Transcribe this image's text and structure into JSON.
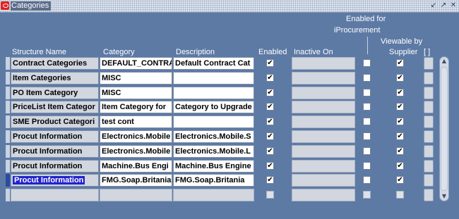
{
  "window": {
    "title": "Categories",
    "controls": [
      "↙",
      "↗",
      "✕"
    ]
  },
  "headers": {
    "structure_name": "Structure Name",
    "category": "Category",
    "description": "Description",
    "enabled": "Enabled",
    "inactive_on": "Inactive On",
    "enabled_for_iproc_line1": "Enabled for",
    "enabled_for_iproc_line2": "iProcurement",
    "viewable_line1": "Viewable by",
    "viewable_line2": "Supplier",
    "dff": "[ ]"
  },
  "rows": [
    {
      "structure": "Contract Categories",
      "category": "DEFAULT_CONTRA",
      "description": "Default Contract Cat",
      "enabled": true,
      "inactive_on": "",
      "iproc": false,
      "viewable": true
    },
    {
      "structure": "Item Categories",
      "category": "MISC",
      "description": "",
      "enabled": true,
      "inactive_on": "",
      "iproc": false,
      "viewable": true
    },
    {
      "structure": "PO Item Category",
      "category": "MISC",
      "description": "",
      "enabled": true,
      "inactive_on": "",
      "iproc": false,
      "viewable": true
    },
    {
      "structure": "PriceList Item Categor",
      "category": "Item Category for",
      "description": "Category to Upgrade",
      "enabled": true,
      "inactive_on": "",
      "iproc": false,
      "viewable": true
    },
    {
      "structure": "SME Product Categori",
      "category": "test cont",
      "description": "",
      "enabled": true,
      "inactive_on": "",
      "iproc": false,
      "viewable": true
    },
    {
      "structure": "Procut Information",
      "category": "Electronics.Mobile",
      "description": "Electronics.Mobile.S",
      "enabled": true,
      "inactive_on": "",
      "iproc": false,
      "viewable": true
    },
    {
      "structure": "Procut Information",
      "category": "Electronics.Mobile",
      "description": "Electronics.Mobile.L",
      "enabled": true,
      "inactive_on": "",
      "iproc": false,
      "viewable": true
    },
    {
      "structure": "Procut Information",
      "category": "Machine.Bus Engi",
      "description": "Machine.Bus Engine",
      "enabled": true,
      "inactive_on": "",
      "iproc": false,
      "viewable": true
    },
    {
      "structure": "Procut Information",
      "category": "FMG.Soap.Britania",
      "description": "FMG.Soap.Britania",
      "enabled": true,
      "inactive_on": "",
      "iproc": false,
      "viewable": true,
      "current": true
    },
    {
      "structure": "",
      "category": "",
      "description": "",
      "enabled": false,
      "inactive_on": "",
      "iproc": false,
      "viewable": false,
      "empty": true
    }
  ],
  "check_glyph": "✔",
  "scrollbar": {
    "up": "▲",
    "down": "▼"
  },
  "colors": {
    "window_bg": "#5d7aa5",
    "frame_bg": "#c9d2e1",
    "selection": "#2222cc",
    "title_icon": "#e02020"
  }
}
